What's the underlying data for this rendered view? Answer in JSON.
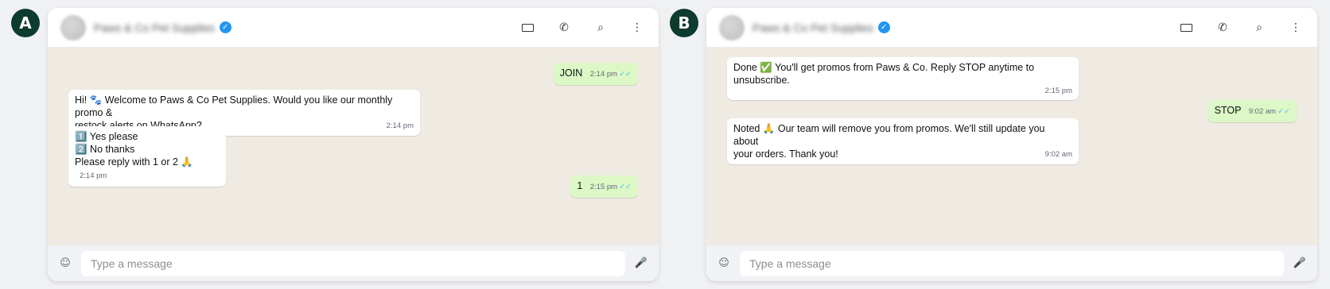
{
  "panels": [
    {
      "label": "A",
      "contact_name": "Paws & Co Pet Supplies",
      "verified_icon": "✓",
      "input_placeholder": "Type a message",
      "messages": [
        {
          "direction": "out",
          "text": "JOIN",
          "time": "2:14 pm",
          "ticks": "✓✓"
        },
        {
          "direction": "in",
          "line1": "Hi! 🐾 Welcome to Paws & Co Pet Supplies. Would you like our monthly promo &",
          "line2": "restock alerts on WhatsApp?",
          "time": "2:14 pm"
        },
        {
          "direction": "in",
          "line1": "1️⃣ Yes please",
          "line2": "2️⃣ No thanks",
          "line3": "Please reply with 1 or 2 🙏",
          "time": "2:14 pm"
        },
        {
          "direction": "out",
          "text": "1",
          "time": "2:15 pm",
          "ticks": "✓✓"
        }
      ]
    },
    {
      "label": "B",
      "contact_name": "Paws & Co Pet Supplies",
      "verified_icon": "✓",
      "input_placeholder": "Type a message",
      "messages": [
        {
          "direction": "in",
          "line1": "Done ✅ You'll get promos from Paws & Co. Reply STOP anytime to unsubscribe.",
          "time": "2:15 pm"
        },
        {
          "direction": "out",
          "text": "STOP",
          "time": "9:02 am",
          "ticks": "✓✓"
        },
        {
          "direction": "in",
          "line1": "Noted 🙏 Our team will remove you from promos. We'll still update you about",
          "line2": "your orders. Thank you!",
          "time": "9:02 am"
        }
      ]
    }
  ],
  "icons": {
    "video": "video-icon",
    "call": "✆",
    "search": "⌕",
    "menu": "⋮",
    "emoji": "☺",
    "mic": "🎤"
  },
  "colors": {
    "badge": "#0d3b2e",
    "chat_bg": "#efeae2",
    "out_bubble": "#dcf8c6",
    "in_bubble": "#ffffff",
    "verified": "#2196f3",
    "ticks": "#53bdeb"
  }
}
